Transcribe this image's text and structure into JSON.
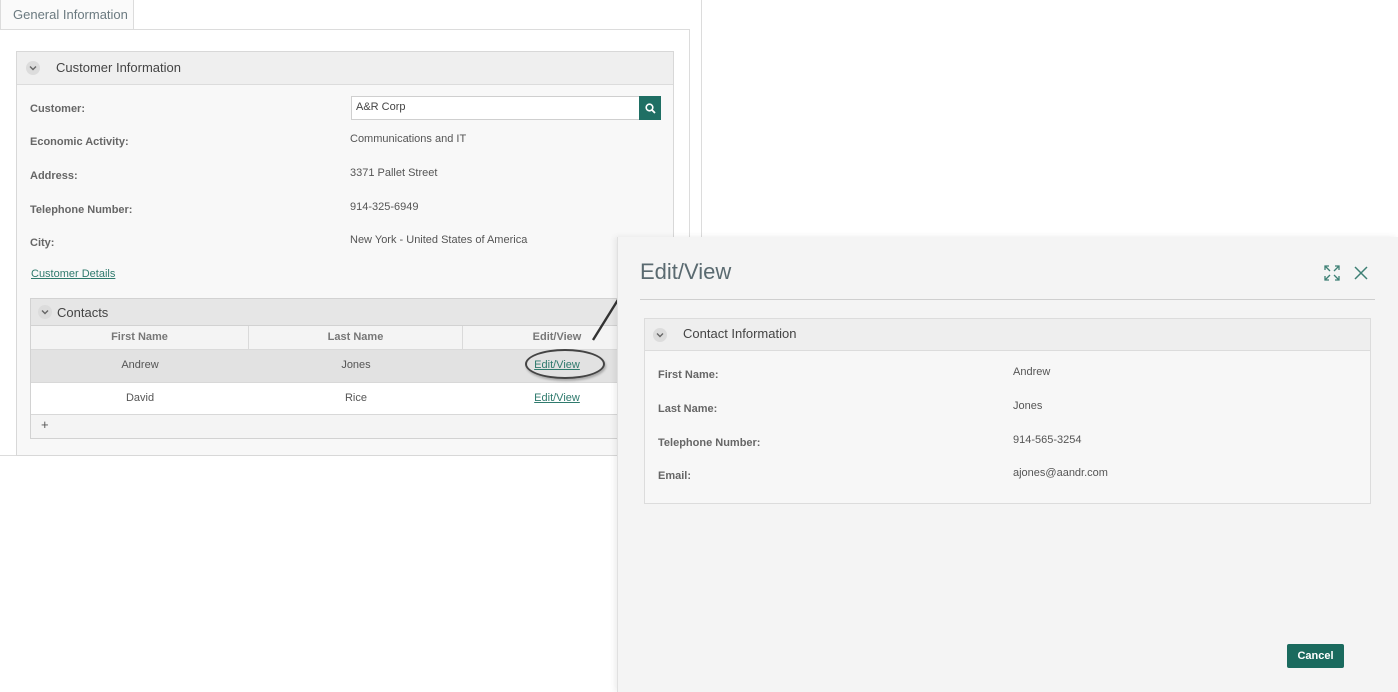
{
  "tabs": {
    "general": "General Information"
  },
  "customer_section": {
    "title": "Customer Information",
    "fields": {
      "customer": {
        "label": "Customer:",
        "value": "A&R Corp"
      },
      "economic_activity": {
        "label": "Economic Activity:",
        "value": "Communications and IT"
      },
      "address": {
        "label": "Address:",
        "value": "3371 Pallet Street"
      },
      "telephone": {
        "label": "Telephone Number:",
        "value": "914-325-6949"
      },
      "city": {
        "label": "City:",
        "value": "New York - United States of America"
      }
    },
    "details_link": "Customer Details"
  },
  "contacts": {
    "title": "Contacts",
    "columns": [
      "First Name",
      "Last Name",
      "Edit/View"
    ],
    "rows": [
      {
        "first": "Andrew",
        "last": "Jones",
        "action": "Edit/View"
      },
      {
        "first": "David",
        "last": "Rice",
        "action": "Edit/View"
      }
    ],
    "add": "+"
  },
  "modal": {
    "title": "Edit/View",
    "section_title": "Contact Information",
    "fields": {
      "first_name": {
        "label": "First Name:",
        "value": "Andrew"
      },
      "last_name": {
        "label": "Last Name:",
        "value": "Jones"
      },
      "telephone": {
        "label": "Telephone Number:",
        "value": "914-565-3254"
      },
      "email": {
        "label": "Email:",
        "value": "ajones@aandr.com"
      }
    },
    "cancel": "Cancel",
    "icons": {
      "expand": "expand-icon",
      "close": "close-icon"
    }
  },
  "colors": {
    "accent": "#1a6a5e",
    "link": "#2f7a6d"
  }
}
